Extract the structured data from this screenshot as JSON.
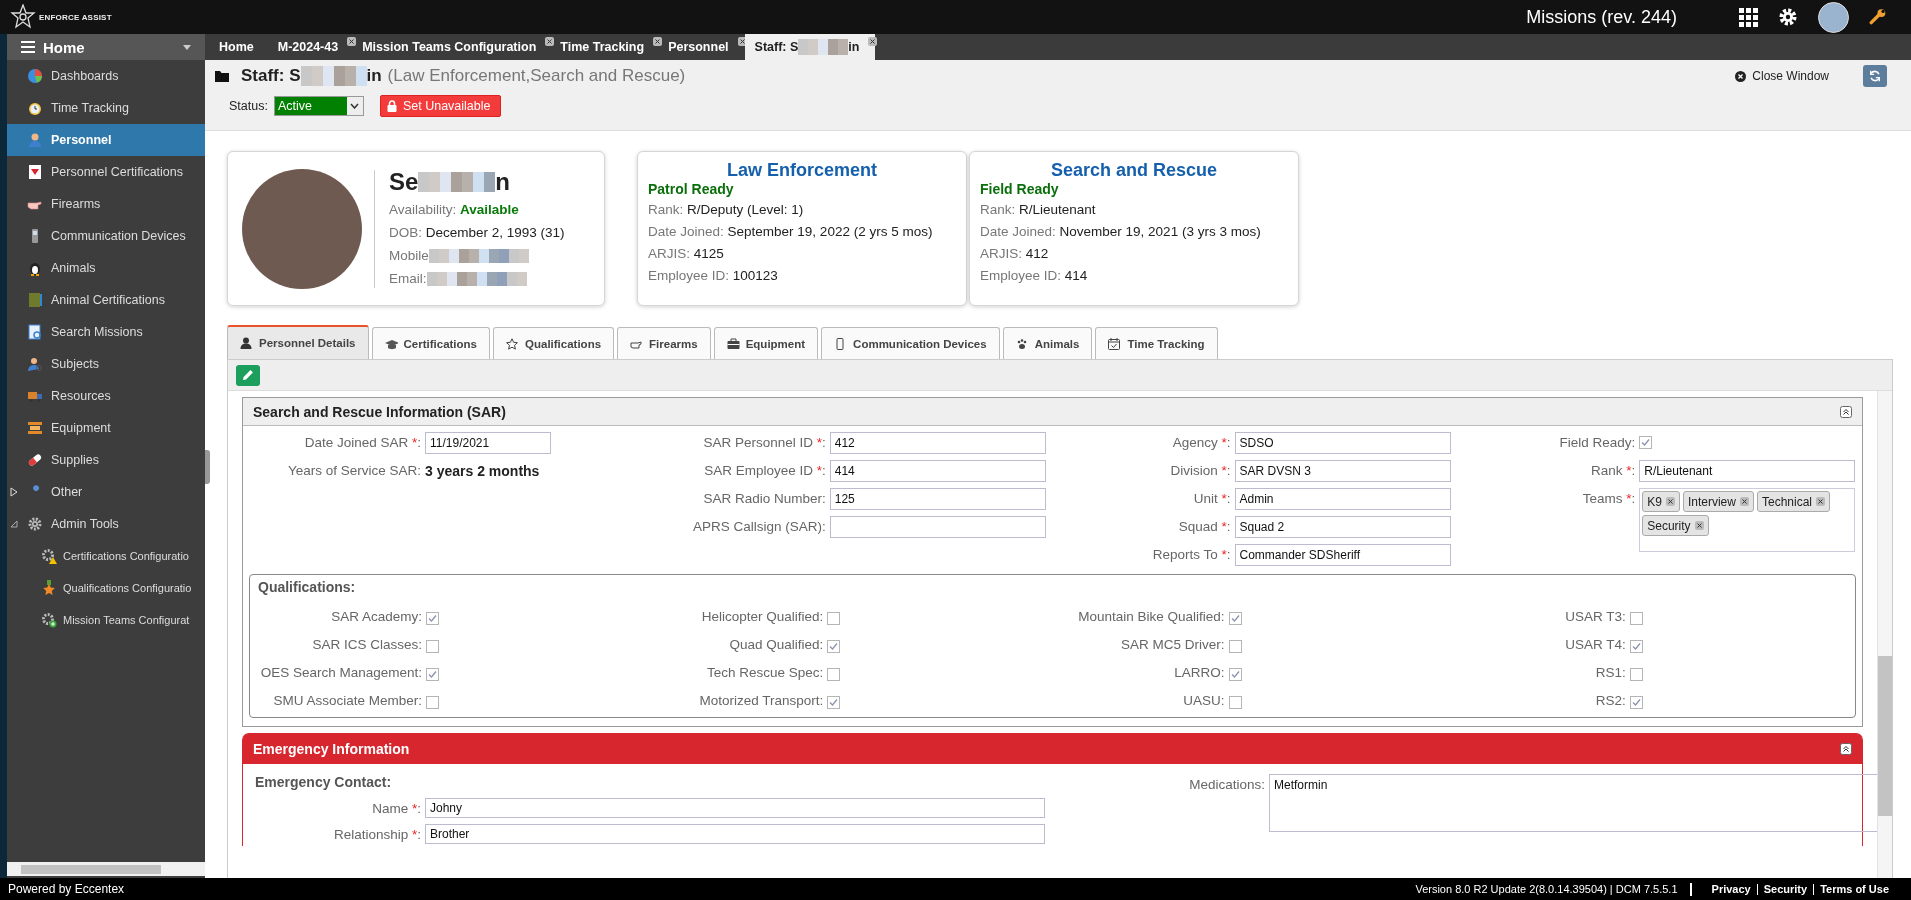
{
  "app": {
    "logo_text": "ENFORCE ASSIST",
    "title": "Missions (rev. 244)"
  },
  "sidebar": {
    "header": "Home",
    "items": [
      {
        "label": "Dashboards",
        "selected": false
      },
      {
        "label": "Time Tracking",
        "selected": false
      },
      {
        "label": "Personnel",
        "selected": true
      },
      {
        "label": "Personnel Certifications",
        "selected": false
      },
      {
        "label": "Firearms",
        "selected": false
      },
      {
        "label": "Communication Devices",
        "selected": false
      },
      {
        "label": "Animals",
        "selected": false
      },
      {
        "label": "Animal Certifications",
        "selected": false
      },
      {
        "label": "Search Missions",
        "selected": false
      },
      {
        "label": "Subjects",
        "selected": false
      },
      {
        "label": "Resources",
        "selected": false
      },
      {
        "label": "Equipment",
        "selected": false
      },
      {
        "label": "Supplies",
        "selected": false
      },
      {
        "label": "Other",
        "selected": false,
        "expanded": false
      },
      {
        "label": "Admin Tools",
        "selected": false,
        "expanded": true,
        "children": [
          {
            "label": "Certifications Configuratio",
            "selected": false
          },
          {
            "label": "Qualifications Configuratio",
            "selected": false
          },
          {
            "label": "Mission Teams Configurat",
            "selected": false
          }
        ]
      }
    ]
  },
  "doc_tabs": [
    {
      "label": "Home",
      "selected": false,
      "closable": false
    },
    {
      "label": "M-2024-43",
      "selected": false,
      "closable": true
    },
    {
      "label": "Mission Teams Configuration",
      "selected": false,
      "closable": true
    },
    {
      "label": "Time Tracking",
      "selected": false,
      "closable": true
    },
    {
      "label": "Personnel",
      "selected": false,
      "closable": true
    },
    {
      "label": "Staff: S",
      "label_end": "in",
      "selected": true,
      "closable": true
    }
  ],
  "page_header": {
    "title": "Staff: S",
    "title_end": "in",
    "subtitle": "(Law Enforcement,Search and Rescue)",
    "status_label": "Status:",
    "status_value": "Active",
    "unavailable_button": "Set Unavailable",
    "close_window": "Close Window"
  },
  "profile": {
    "name": "Se",
    "name_end": "n",
    "rows": [
      {
        "label": "Availability: ",
        "value": "Available",
        "kind": "status"
      },
      {
        "label": "DOB: ",
        "value": "December 2, 1993 (31)",
        "kind": "text"
      },
      {
        "label": "Mobile",
        "kind": "redacted"
      },
      {
        "label": "Email:",
        "kind": "redacted"
      }
    ]
  },
  "assignments": [
    {
      "title": "Law Enforcement",
      "readiness": "Patrol Ready",
      "rows": [
        {
          "label": "Rank: ",
          "value": "R/Deputy (Level: 1)"
        },
        {
          "label": "Date Joined: ",
          "value": "September 19, 2022 (2 yrs 5 mos)"
        },
        {
          "label": "ARJIS: ",
          "value": "4125"
        },
        {
          "label": "Employee ID: ",
          "value": "100123"
        }
      ]
    },
    {
      "title": "Search and Rescue",
      "readiness": "Field Ready",
      "rows": [
        {
          "label": "Rank: ",
          "value": "R/Lieutenant"
        },
        {
          "label": "Date Joined: ",
          "value": "November 19, 2021 (3 yrs 3 mos)"
        },
        {
          "label": "ARJIS: ",
          "value": "412"
        },
        {
          "label": "Employee ID: ",
          "value": "414"
        }
      ]
    }
  ],
  "detail_tabs": [
    {
      "label": "Personnel Details",
      "selected": true
    },
    {
      "label": "Certifications",
      "selected": false
    },
    {
      "label": "Qualifications",
      "selected": false
    },
    {
      "label": "Firearms",
      "selected": false
    },
    {
      "label": "Equipment",
      "selected": false
    },
    {
      "label": "Communication Devices",
      "selected": false
    },
    {
      "label": "Animals",
      "selected": false
    },
    {
      "label": "Time Tracking",
      "selected": false
    }
  ],
  "sar_section": {
    "title": "Search and Rescue Information (SAR)",
    "columns": [
      [
        {
          "label": "Date Joined SAR ",
          "req": "*",
          "sep": ":",
          "kind": "date",
          "value": "11/19/2021"
        },
        {
          "label": "Years of Service SAR:",
          "kind": "static",
          "value": "3 years 2 months"
        }
      ],
      [
        {
          "label": "SAR Personnel ID ",
          "req": "*",
          "sep": ":",
          "kind": "input",
          "value": "412"
        },
        {
          "label": "SAR Employee ID ",
          "req": "*",
          "sep": ":",
          "kind": "input",
          "value": "414"
        },
        {
          "label": "SAR Radio Number:",
          "kind": "input",
          "value": "125"
        },
        {
          "label": "APRS Callsign (SAR):",
          "kind": "input"
        }
      ],
      [
        {
          "label": "Agency ",
          "req": "*",
          "sep": ":",
          "kind": "input",
          "value": "SDSO"
        },
        {
          "label": "Division ",
          "req": "*",
          "sep": ":",
          "kind": "input",
          "value": "SAR DVSN 3"
        },
        {
          "label": "Unit ",
          "req": "*",
          "sep": ":",
          "kind": "input",
          "value": "Admin"
        },
        {
          "label": "Squad ",
          "req": "*",
          "sep": ":",
          "kind": "input",
          "value": "Squad 2"
        },
        {
          "label": "Reports To ",
          "req": "*",
          "sep": ":",
          "kind": "input",
          "value": "Commander SDSheriff"
        }
      ],
      [
        {
          "label": "Field Ready:",
          "kind": "checkbox",
          "checked": true
        },
        {
          "label": "Rank ",
          "req": "*",
          "sep": ":",
          "kind": "input",
          "value": "R/Lieutenant"
        },
        {
          "label": "Teams ",
          "req": "*",
          "sep": ":",
          "kind": "tags",
          "tags": [
            "K9",
            "Interview",
            "Technical",
            "Security"
          ]
        }
      ]
    ],
    "qualifications": {
      "title": "Qualifications:",
      "columns": [
        [
          {
            "label": "SAR Academy:",
            "checked": true
          },
          {
            "label": "SAR ICS Classes:",
            "checked": false
          },
          {
            "label": "OES Search Management:",
            "checked": true
          },
          {
            "label": "SMU Associate Member:",
            "checked": false
          }
        ],
        [
          {
            "label": "Helicopter Qualified:",
            "checked": false
          },
          {
            "label": "Quad Qualified:",
            "checked": true
          },
          {
            "label": "Tech Rescue Spec:",
            "checked": false
          },
          {
            "label": "Motorized Transport:",
            "checked": true
          }
        ],
        [
          {
            "label": "Mountain Bike Qualified:",
            "checked": true
          },
          {
            "label": "SAR MC5 Driver:",
            "checked": false
          },
          {
            "label": "LARRO:",
            "checked": true
          },
          {
            "label": "UASU:",
            "checked": false
          }
        ],
        [
          {
            "label": "USAR T3:",
            "checked": false
          },
          {
            "label": "USAR T4:",
            "checked": true
          },
          {
            "label": "RS1:",
            "checked": false
          },
          {
            "label": "RS2:",
            "checked": true
          }
        ]
      ]
    }
  },
  "emergency_section": {
    "title": "Emergency Information",
    "contact_heading": "Emergency Contact:",
    "fields": [
      {
        "label": "Name ",
        "req": "*",
        "sep": ":",
        "kind": "input",
        "value": "Johny"
      },
      {
        "label": "Relationship ",
        "req": "*",
        "sep": ":",
        "kind": "input",
        "value": "Brother"
      }
    ],
    "medications": {
      "label": "Medications:",
      "value": "Metformin"
    }
  },
  "footer": {
    "powered_by": "Powered by Eccentex",
    "version": "Version  8.0 R2 Update 2(8.0.14.39504) | DCM 7.5.5.1",
    "links": [
      "Privacy",
      "Security",
      "Terms of Use"
    ]
  }
}
